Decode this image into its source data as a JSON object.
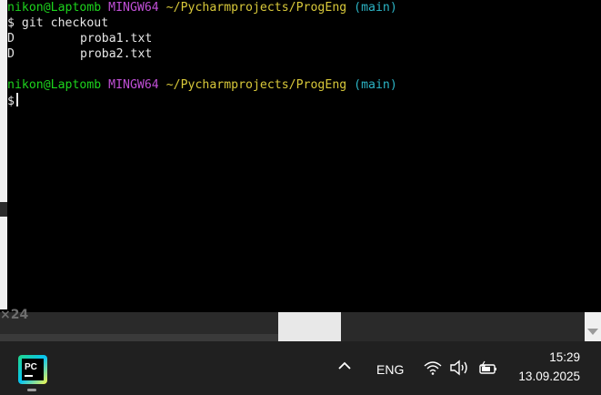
{
  "terminal": {
    "prompt1": {
      "user": "nikon@Laptomb",
      "system": "MINGW64",
      "path": "~/Pycharmprojects/ProgEng",
      "branch": "(main)"
    },
    "cmd1": "$ git checkout",
    "out1": {
      "status": "D",
      "file": "proba1.txt"
    },
    "out2": {
      "status": "D",
      "file": "proba2.txt"
    },
    "prompt2": {
      "user": "nikon@Laptomb",
      "system": "MINGW64",
      "path": "~/Pycharmprojects/ProgEng",
      "branch": "(main)"
    },
    "prompt_symbol": "$"
  },
  "behind_window": {
    "text": "×24"
  },
  "taskbar": {
    "app_icon": "pycharm-icon",
    "language": "ENG",
    "time": "15:29",
    "date": "13.09.2025"
  },
  "colors": {
    "user": "#1dd31d",
    "system": "#c04fd6",
    "path": "#d8c83a",
    "branch": "#2cb5c6",
    "terminal_bg": "#000000",
    "taskbar_bg": "#202020"
  }
}
